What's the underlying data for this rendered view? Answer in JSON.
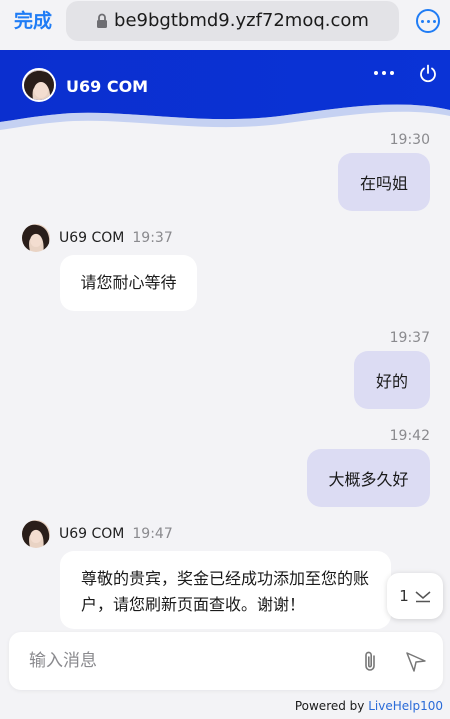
{
  "browser": {
    "done_label": "完成",
    "url": "be9bgtbmd9.yzf72moq.com"
  },
  "chat_header": {
    "title": "U69 COM"
  },
  "messages": [
    {
      "from": "visitor",
      "time": "19:30",
      "text": "在吗姐"
    },
    {
      "from": "agent",
      "name": "U69 COM",
      "time": "19:37",
      "text": "请您耐心等待"
    },
    {
      "from": "visitor",
      "time": "19:37",
      "text": "好的"
    },
    {
      "from": "visitor",
      "time": "19:42",
      "text": "大概多久好"
    },
    {
      "from": "agent",
      "name": "U69 COM",
      "time": "19:47",
      "text_line1": "尊敬的贵宾，奖金已经成功添加至您的账",
      "text_line2": "户，请您刷新页面查收。谢谢！"
    }
  ],
  "new_messages_count": "1",
  "composer": {
    "placeholder": "输入消息"
  },
  "footer": {
    "powered_by": "Powered by",
    "brand": "LiveHelp100"
  },
  "colors": {
    "accent": "#1f7cf5",
    "header_blue": "#0a2fd0",
    "visitor_bubble": "#dcdcf3"
  }
}
